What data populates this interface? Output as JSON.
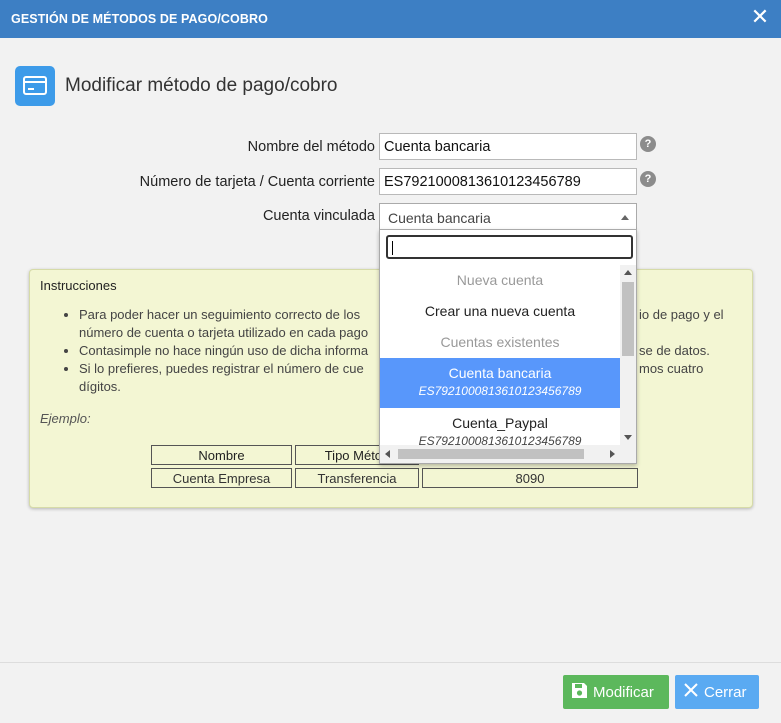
{
  "window": {
    "title": "GESTIÓN DE MÉTODOS DE PAGO/COBRO",
    "close_icon": "close-icon"
  },
  "header": {
    "icon": "credit-card-icon",
    "title": "Modificar método de pago/cobro"
  },
  "form": {
    "name_label": "Nombre del método",
    "name_value": "Cuenta bancaria",
    "account_label": "Número de tarjeta / Cuenta corriente",
    "account_value": "ES7921000813610123456789",
    "linked_label": "Cuenta vinculada",
    "linked_value": "Cuenta bancaria",
    "help_glyph": "?"
  },
  "dropdown": {
    "search_value": "",
    "groups": [
      {
        "label": "Nueva cuenta",
        "options": [
          {
            "label": "Crear una nueva cuenta"
          }
        ]
      },
      {
        "label": "Cuentas existentes",
        "options": [
          {
            "label": "Cuenta bancaria",
            "sub": "ES7921000813610123456789",
            "selected": true
          },
          {
            "label": "Cuenta_Paypal",
            "sub": "ES7921000813610123456789",
            "selected": false
          }
        ]
      }
    ]
  },
  "instructions": {
    "title": "Instrucciones",
    "items": [
      "Para poder hacer un seguimiento correcto de los",
      "io de pago y el",
      "número de cuenta o tarjeta utilizado en cada pago",
      "Contasimple no hace ningún uso de dicha informa",
      "se de datos.",
      "Si lo prefieres, puedes registrar el número de cue",
      "mos cuatro",
      "dígitos."
    ],
    "example_label": "Ejemplo:",
    "table": {
      "headers": [
        "Nombre",
        "Tipo Métod"
      ],
      "row": [
        "Cuenta Empresa",
        "Transferencia",
        "8090"
      ]
    }
  },
  "buttons": {
    "modify_label": "Modificar",
    "close_label": "Cerrar"
  },
  "colors": {
    "titlebar": "#3d7fc4",
    "accent_icon": "#3d9be9",
    "instructions_bg": "#f3f6d3",
    "selected_option": "#5897fb",
    "modify_button": "#5cb85c",
    "close_button": "#5aaaf2"
  }
}
